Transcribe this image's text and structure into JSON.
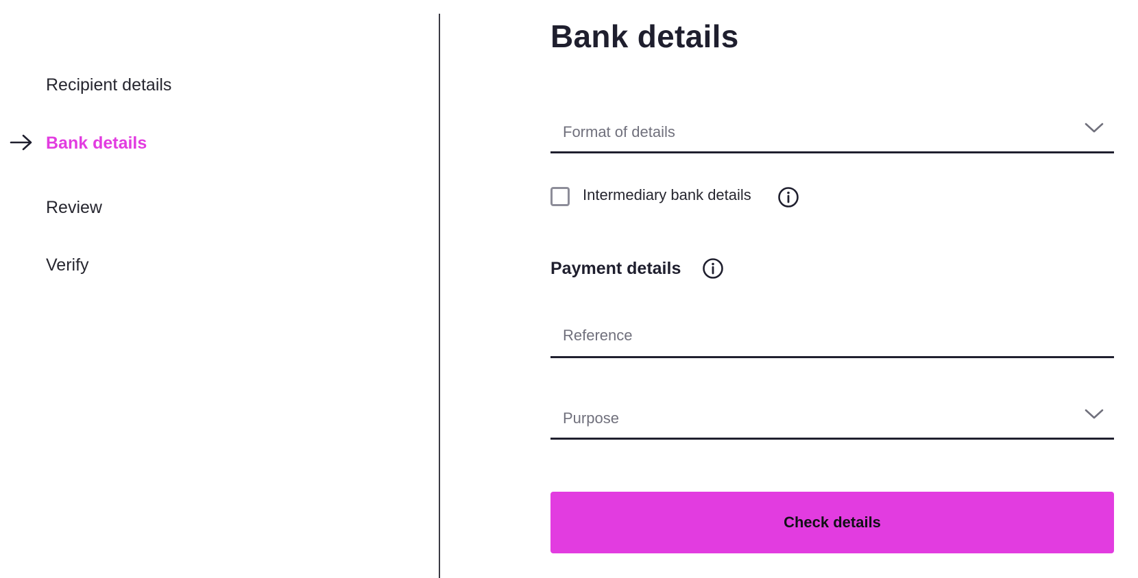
{
  "stepper": {
    "steps": [
      {
        "label": "Recipient details",
        "active": false
      },
      {
        "label": "Bank details",
        "active": true
      },
      {
        "label": "Review",
        "active": false
      },
      {
        "label": "Verify",
        "active": false
      }
    ],
    "active_color": "#e23ce0",
    "active_indicator_icon": "arrow-right-icon"
  },
  "form": {
    "title": "Bank details",
    "format_field": {
      "placeholder": "Format of details",
      "icon": "chevron-down-icon"
    },
    "intermediary": {
      "label": "Intermediary bank details",
      "checked": false,
      "icon": "info-icon"
    },
    "payment_section": {
      "title": "Payment details",
      "icon": "info-icon"
    },
    "reference_field": {
      "placeholder": "Reference",
      "value": ""
    },
    "purpose_field": {
      "placeholder": "Purpose",
      "icon": "chevron-down-icon"
    },
    "submit": {
      "label": "Check details",
      "color": "#e23ce0"
    }
  }
}
